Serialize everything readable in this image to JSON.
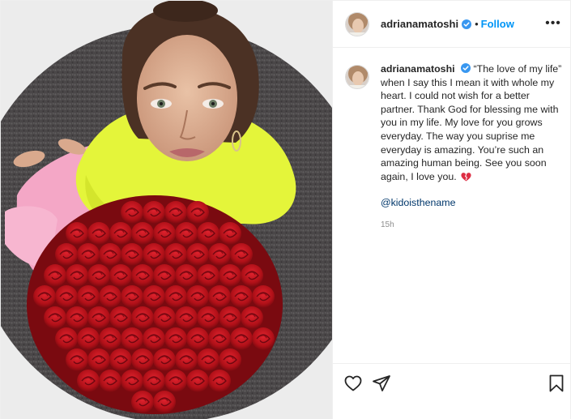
{
  "post": {
    "author": {
      "username": "adrianamatoshi",
      "verified": true
    },
    "follow_label": "Follow",
    "header_separator": "•",
    "more_label": "•••",
    "caption": {
      "username": "adrianamatoshi",
      "text": "“The love of my life” when I say this I mean it with whole my heart. I could not wish for a better partner. Thank God for blessing me with you in my life. My love for you grows everyday. The way you suprise me everyday is amazing. You’re such an amazing human being. See you soon again, I love you.",
      "emoji": "broken-heart-icon",
      "mention": "@kidoisthename",
      "time": "15h"
    },
    "actions": [
      "heart-icon",
      "share-icon",
      "bookmark-icon"
    ]
  },
  "colors": {
    "accent": "#0095f6",
    "mention": "#00376b",
    "muted": "#8e8e8e",
    "verified": "#3897f0",
    "sweater": "#e4f53a",
    "roses": "#c1121c",
    "rug": "#4a4748"
  }
}
